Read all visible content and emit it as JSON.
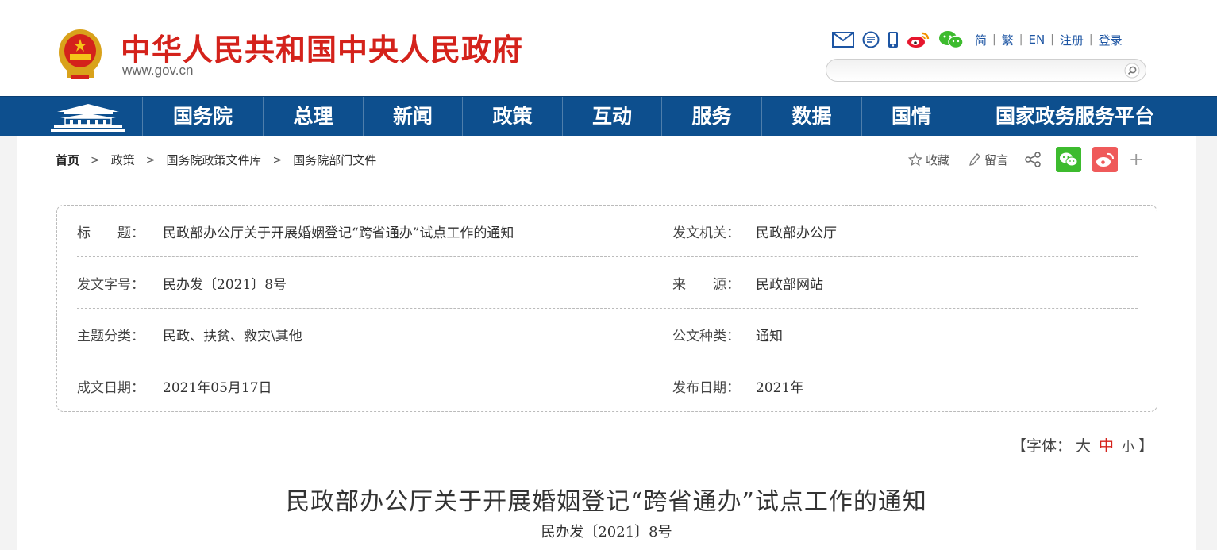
{
  "colors": {
    "brand_red": "#d4221b",
    "nav_blue": "#0d4f8e",
    "link_blue": "#1d55a3",
    "wechat_green": "#3dbb2e",
    "weibo_red": "#ef5a5a"
  },
  "header": {
    "title": "中华人民共和国中央人民政府",
    "domain": "www.gov.cn",
    "tools": [
      "mail-icon",
      "message-icon",
      "mobile-icon",
      "weibo-icon",
      "wechat-icon"
    ],
    "lang_links": [
      "简",
      "繁",
      "EN",
      "注册",
      "登录"
    ],
    "search": {
      "placeholder": "",
      "value": ""
    }
  },
  "nav": {
    "items": [
      "国务院",
      "总理",
      "新闻",
      "政策",
      "互动",
      "服务",
      "数据",
      "国情",
      "国家政务服务平台"
    ]
  },
  "breadcrumb": [
    "首页",
    "政策",
    "国务院政策文件库",
    "国务院部门文件"
  ],
  "share_bar": {
    "favorite": "收藏",
    "comment": "留言",
    "more": "+"
  },
  "info": {
    "rows": [
      {
        "l1": "标　　题：",
        "v1": "民政部办公厅关于开展婚姻登记“跨省通办”试点工作的通知",
        "l2": "发文机关：",
        "v2": "民政部办公厅"
      },
      {
        "l1": "发文字号：",
        "v1": "民办发〔2021〕8号",
        "l2": "来　　源：",
        "v2": "民政部网站"
      },
      {
        "l1": "主题分类：",
        "v1": "民政、扶贫、救灾\\其他",
        "l2": "公文种类：",
        "v2": "通知"
      },
      {
        "l1": "成文日期：",
        "v1": "2021年05月17日",
        "l2": "发布日期：",
        "v2": "2021年"
      }
    ]
  },
  "font_size": {
    "prefix": "【字体：",
    "large": "大",
    "medium": "中",
    "small": "小",
    "suffix": "】"
  },
  "article": {
    "title": "民政部办公厅关于开展婚姻登记“跨省通办”试点工作的通知",
    "doc_no": "民办发〔2021〕8号"
  }
}
